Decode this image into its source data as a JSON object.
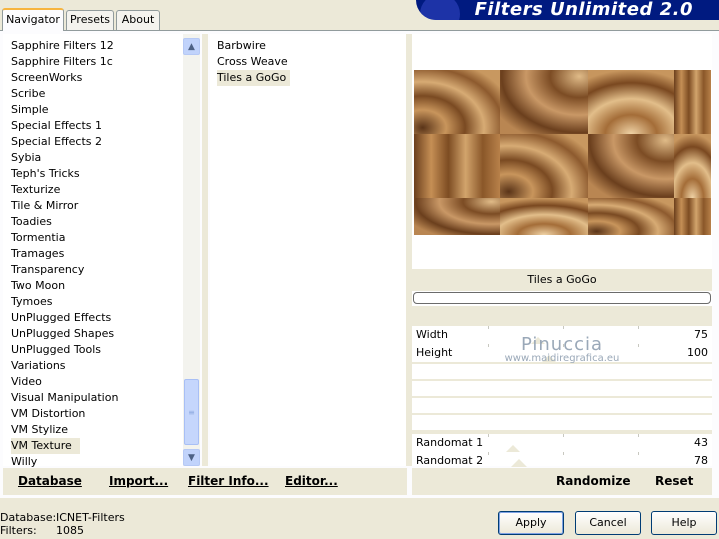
{
  "tabs": [
    {
      "label": "Navigator",
      "active": true
    },
    {
      "label": "Presets",
      "active": false
    },
    {
      "label": "About",
      "active": false
    }
  ],
  "banner": {
    "title": "Filters Unlimited 2.0"
  },
  "categories": [
    "Sapphire Filters 12",
    "Sapphire Filters 1c",
    "ScreenWorks",
    "Scribe",
    "Simple",
    "Special Effects 1",
    "Special Effects 2",
    "Sybia",
    "Teph's Tricks",
    "Texturize",
    "Tile & Mirror",
    "Toadies",
    "Tormentia",
    "Tramages",
    "Transparency",
    "Two Moon",
    "Tymoes",
    "UnPlugged Effects",
    "UnPlugged Shapes",
    "UnPlugged Tools",
    "Variations",
    "Video",
    "Visual Manipulation",
    "VM Distortion",
    "VM Stylize",
    "VM Texture",
    "Willy"
  ],
  "selected_category": "VM Texture",
  "filters": [
    "Barbwire",
    "Cross Weave",
    "Tiles a GoGo"
  ],
  "selected_filter": "Tiles a GoGo",
  "preview_title": "Tiles a GoGo",
  "params": {
    "width": {
      "label": "Width",
      "value": "75",
      "fraction": 0.75
    },
    "height": {
      "label": "Height",
      "value": "100",
      "fraction": 1.0
    },
    "randomat1": {
      "label": "Randomat 1",
      "value": "43",
      "fraction": 0.17
    },
    "randomat2": {
      "label": "Randomat 2",
      "value": "78",
      "fraction": 0.31
    }
  },
  "watermark": {
    "name": "Pinuccia",
    "url": "www.maidiregrafica.eu"
  },
  "bottom_links": {
    "database": "Database",
    "import": "Import...",
    "filter_info": "Filter Info...",
    "editor": "Editor...",
    "randomize": "Randomize",
    "reset": "Reset"
  },
  "footer": {
    "database_label": "Database:",
    "database_value": "ICNET-Filters",
    "filters_label": "Filters:",
    "filters_value": "1085"
  },
  "buttons": {
    "apply": "Apply",
    "cancel": "Cancel",
    "help": "Help"
  },
  "colors": {
    "banner": "#001a80",
    "tab_highlight": "#f7b53f",
    "panel": "#ece9d8"
  }
}
